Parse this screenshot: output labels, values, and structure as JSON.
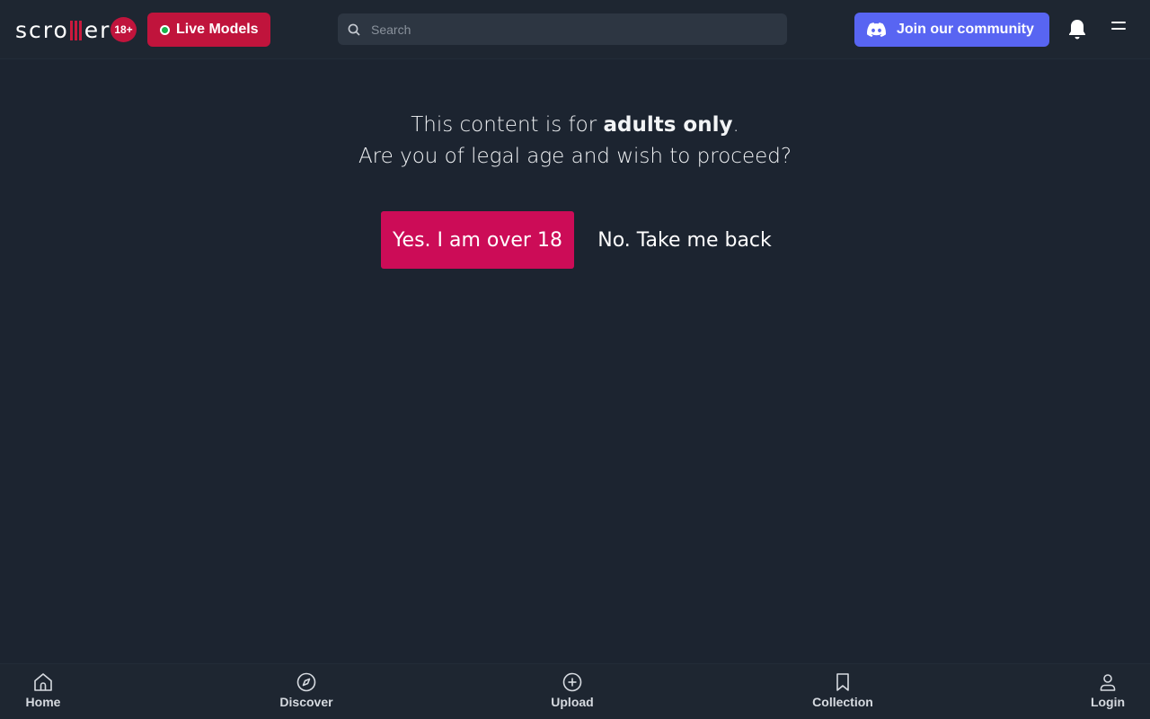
{
  "header": {
    "logo_left": "scro",
    "logo_right": "er",
    "age_badge": "18+",
    "live_models_label": "Live Models",
    "search_placeholder": "Search",
    "community_label": "Join our community"
  },
  "gate": {
    "line1_prefix": "This content is for ",
    "line1_bold": "adults only",
    "line1_suffix": ".",
    "line2": "Are you of legal age and wish to proceed?",
    "yes_label": "Yes. I am over 18",
    "no_label": "No. Take me back"
  },
  "bottom_nav": {
    "items": [
      {
        "label": "Home",
        "icon": "home-icon"
      },
      {
        "label": "Discover",
        "icon": "compass-icon"
      },
      {
        "label": "Upload",
        "icon": "plus-circle-icon"
      },
      {
        "label": "Collection",
        "icon": "bookmark-icon"
      },
      {
        "label": "Login",
        "icon": "user-icon"
      }
    ]
  },
  "colors": {
    "background": "#1c2430",
    "brand_red": "#c0143c",
    "accept_button": "#cc0c57",
    "discord": "#5865f2"
  }
}
